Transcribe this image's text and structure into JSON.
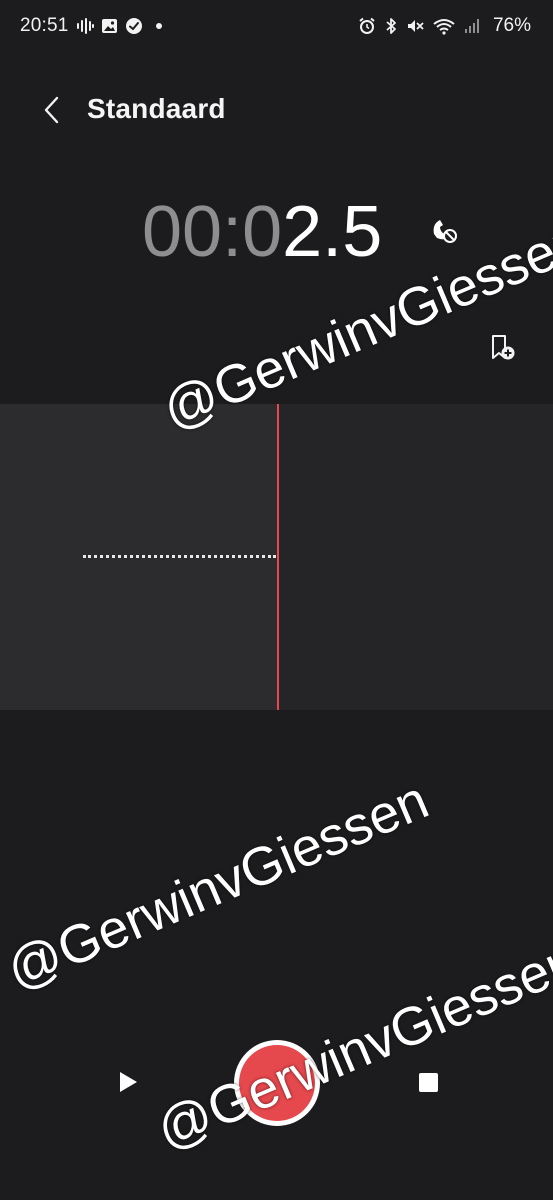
{
  "status_bar": {
    "time": "20:51",
    "battery": "76%",
    "left_icons": [
      "voice-recording-icon",
      "gallery-icon",
      "check-badge-icon",
      "dot-icon"
    ],
    "right_icons": [
      "alarm-icon",
      "bluetooth-icon",
      "mute-icon",
      "wifi-icon",
      "signal-icon"
    ]
  },
  "header": {
    "title": "Standaard"
  },
  "timer": {
    "dim_part": "00:0",
    "bright_part": "2.5"
  },
  "waveform": {
    "playhead_color": "#e5484d"
  },
  "controls": {
    "play_icon": "play-icon",
    "record_color": "#e5484d",
    "stop_icon": "stop-icon"
  },
  "watermark": {
    "text_1": "@GerwinvGiessen",
    "text_2": "@GerwinvGiessen",
    "text_3": "@GerwinvGiessen"
  }
}
